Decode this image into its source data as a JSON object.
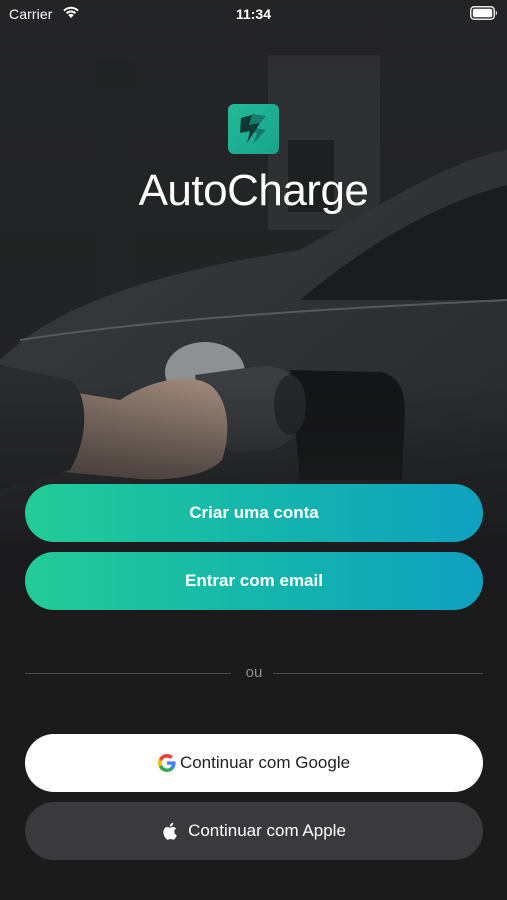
{
  "status_bar": {
    "carrier": "Carrier",
    "time": "11:34"
  },
  "brand": {
    "name": "AutoCharge",
    "accent_color": "#22B998"
  },
  "actions": {
    "create_account_label": "Criar uma conta",
    "email_login_label": "Entrar com email",
    "divider_label": "ou",
    "google_label": "Continuar com Google",
    "apple_label": "Continuar com Apple"
  },
  "colors": {
    "gradient_start": "#23CC96",
    "gradient_end": "#0FA1C0",
    "background": "#1B1B1C",
    "apple_button": "#3A3A3C"
  },
  "icons": {
    "wifi": "wifi-icon",
    "battery": "battery-icon",
    "logo": "autocharge-logo-icon",
    "google": "google-icon",
    "apple": "apple-icon"
  }
}
